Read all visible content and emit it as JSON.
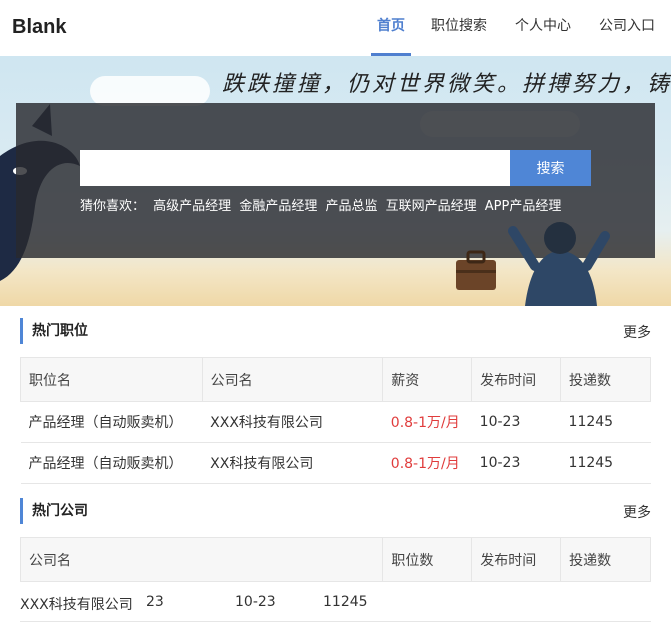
{
  "header": {
    "logo": "Blank",
    "nav": [
      "首页",
      "职位搜索",
      "个人中心",
      "公司入口"
    ]
  },
  "banner": {
    "slogan": "跌跌撞撞，仍对世界微笑。拼搏努力，铸就",
    "search_placeholder": "",
    "search_button": "搜索",
    "guess_label": "猜你喜欢：",
    "keywords": [
      "高级产品经理",
      "金融产品经理",
      "产品总监",
      "互联网产品经理",
      "APP产品经理"
    ]
  },
  "hot_jobs": {
    "title": "热门职位",
    "more": "更多",
    "columns": [
      "职位名",
      "公司名",
      "薪资",
      "发布时间",
      "投递数"
    ],
    "rows": [
      [
        "产品经理（自动贩卖机）",
        "XXX科技有限公司",
        "0.8-1万/月",
        "10-23",
        "11245"
      ],
      [
        "产品经理（自动贩卖机）",
        "XX科技有限公司",
        "0.8-1万/月",
        "10-23",
        "11245"
      ]
    ]
  },
  "hot_companies": {
    "title": "热门公司",
    "more": "更多",
    "columns": [
      "公司名",
      "职位数",
      "发布时间",
      "投递数"
    ],
    "rows": [
      [
        "XXX科技有限公司",
        "23",
        "10-23",
        "11245"
      ]
    ]
  },
  "colors": {
    "accent": "#4f86d6",
    "salary": "#e03c3c"
  }
}
